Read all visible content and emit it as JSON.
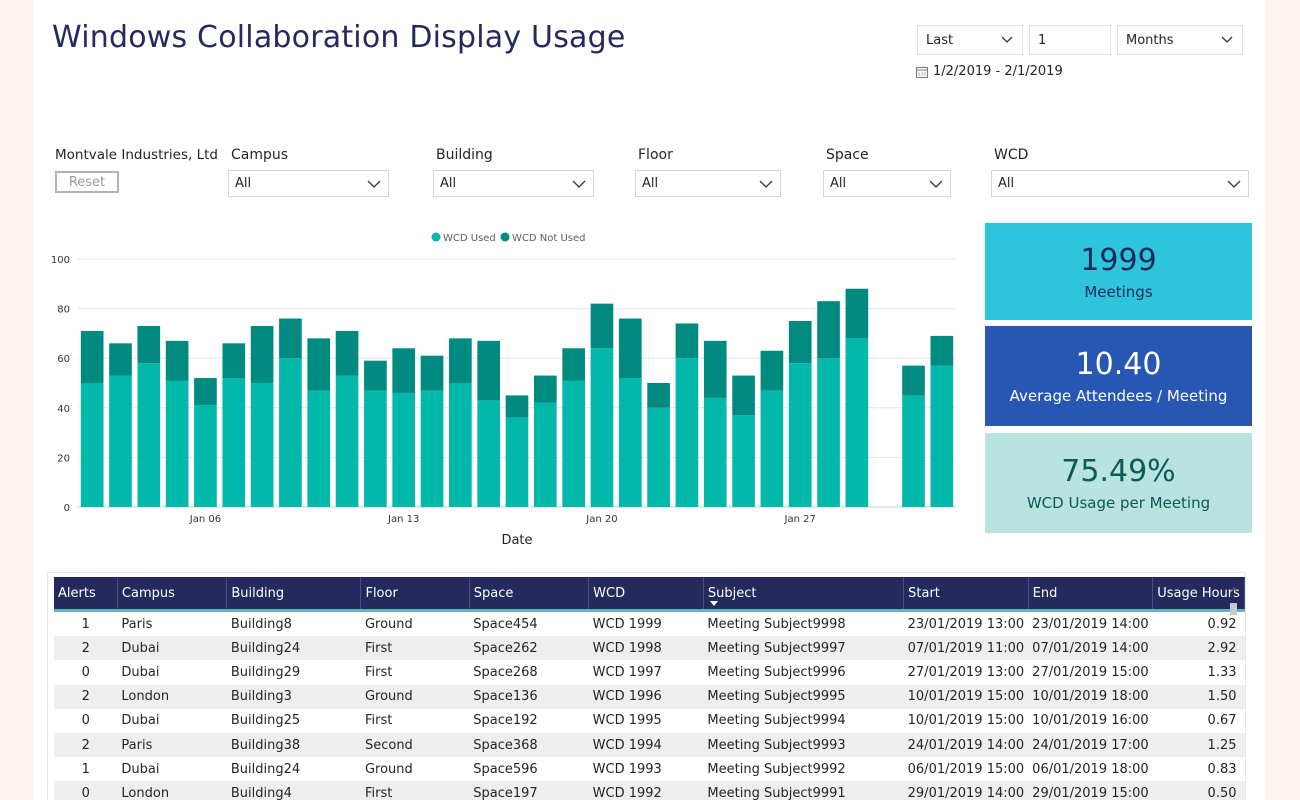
{
  "title": "Windows Collaboration Display Usage",
  "date_filter": {
    "mode": "Last",
    "count": "1",
    "unit": "Months",
    "range": "1/2/2019 - 2/1/2019"
  },
  "org_name": "Montvale Industries, Ltd",
  "reset_label": "Reset",
  "slicers": [
    {
      "label": "Campus",
      "value": "All"
    },
    {
      "label": "Building",
      "value": "All"
    },
    {
      "label": "Floor",
      "value": "All"
    },
    {
      "label": "Space",
      "value": "All"
    },
    {
      "label": "WCD",
      "value": "All"
    }
  ],
  "kpis": [
    {
      "value": "1999",
      "label": "Meetings",
      "bg": "#2dc4dc",
      "fg": "#1f2a5c"
    },
    {
      "value": "10.40",
      "label": "Average Attendees / Meeting",
      "bg": "#2756b3",
      "fg": "#ffffff"
    },
    {
      "value": "75.49%",
      "label": "WCD Usage per Meeting",
      "bg": "#b9e3df",
      "fg": "#0c5a58"
    }
  ],
  "chart_data": {
    "type": "bar",
    "stacked": true,
    "xlabel": "Date",
    "ylabel": "",
    "ylim": [
      0,
      100
    ],
    "yticks": [
      0,
      20,
      40,
      60,
      80,
      100
    ],
    "xtick_labels": [
      "Jan 06",
      "Jan 13",
      "Jan 20",
      "Jan 27"
    ],
    "legend_position": "top-center",
    "categories": [
      "Jan 02",
      "Jan 03",
      "Jan 04",
      "Jan 05",
      "Jan 06",
      "Jan 07",
      "Jan 08",
      "Jan 09",
      "Jan 10",
      "Jan 11",
      "Jan 12",
      "Jan 13",
      "Jan 14",
      "Jan 15",
      "Jan 16",
      "Jan 17",
      "Jan 18",
      "Jan 19",
      "Jan 20",
      "Jan 21",
      "Jan 22",
      "Jan 23",
      "Jan 24",
      "Jan 25",
      "Jan 26",
      "Jan 27",
      "Jan 28",
      "Jan 29",
      "Jan 30",
      "Jan 31",
      "Feb 01"
    ],
    "series": [
      {
        "name": "WCD Used",
        "color": "#01b8aa",
        "values": [
          50,
          53,
          58,
          51,
          41,
          52,
          50,
          60,
          47,
          53,
          47,
          46,
          47,
          50,
          43,
          36,
          42,
          51,
          64,
          52,
          40,
          60,
          44,
          37,
          47,
          58,
          60,
          68,
          null,
          45,
          57
        ]
      },
      {
        "name": "WCD Not Used",
        "color": "#018a80",
        "values": [
          21,
          13,
          15,
          16,
          11,
          14,
          23,
          16,
          21,
          18,
          12,
          18,
          14,
          18,
          24,
          9,
          11,
          13,
          18,
          24,
          10,
          14,
          23,
          16,
          16,
          17,
          23,
          20,
          null,
          12,
          12
        ]
      }
    ]
  },
  "table": {
    "columns": [
      "Alerts",
      "Campus",
      "Building",
      "Floor",
      "Space",
      "WCD",
      "Subject",
      "Start",
      "End",
      "Usage Hours"
    ],
    "sorted_column": "Subject",
    "rows": [
      [
        "1",
        "Paris",
        "Building8",
        "Ground",
        "Space454",
        "WCD 1999",
        "Meeting Subject9998",
        "23/01/2019 13:00",
        "23/01/2019 14:00",
        "0.92"
      ],
      [
        "2",
        "Dubai",
        "Building24",
        "First",
        "Space262",
        "WCD 1998",
        "Meeting Subject9997",
        "07/01/2019 11:00",
        "07/01/2019 14:00",
        "2.92"
      ],
      [
        "0",
        "Dubai",
        "Building29",
        "First",
        "Space268",
        "WCD 1997",
        "Meeting Subject9996",
        "27/01/2019 13:00",
        "27/01/2019 15:00",
        "1.33"
      ],
      [
        "2",
        "London",
        "Building3",
        "Ground",
        "Space136",
        "WCD 1996",
        "Meeting Subject9995",
        "10/01/2019 15:00",
        "10/01/2019 18:00",
        "1.50"
      ],
      [
        "0",
        "Dubai",
        "Building25",
        "First",
        "Space192",
        "WCD 1995",
        "Meeting Subject9994",
        "10/01/2019 15:00",
        "10/01/2019 16:00",
        "0.67"
      ],
      [
        "2",
        "Paris",
        "Building38",
        "Second",
        "Space368",
        "WCD 1994",
        "Meeting Subject9993",
        "24/01/2019 14:00",
        "24/01/2019 17:00",
        "1.25"
      ],
      [
        "1",
        "Dubai",
        "Building24",
        "Ground",
        "Space596",
        "WCD 1993",
        "Meeting Subject9992",
        "06/01/2019 15:00",
        "06/01/2019 18:00",
        "0.83"
      ],
      [
        "0",
        "London",
        "Building4",
        "First",
        "Space197",
        "WCD 1992",
        "Meeting Subject9991",
        "29/01/2019 14:00",
        "29/01/2019 15:00",
        "0.50"
      ]
    ]
  }
}
